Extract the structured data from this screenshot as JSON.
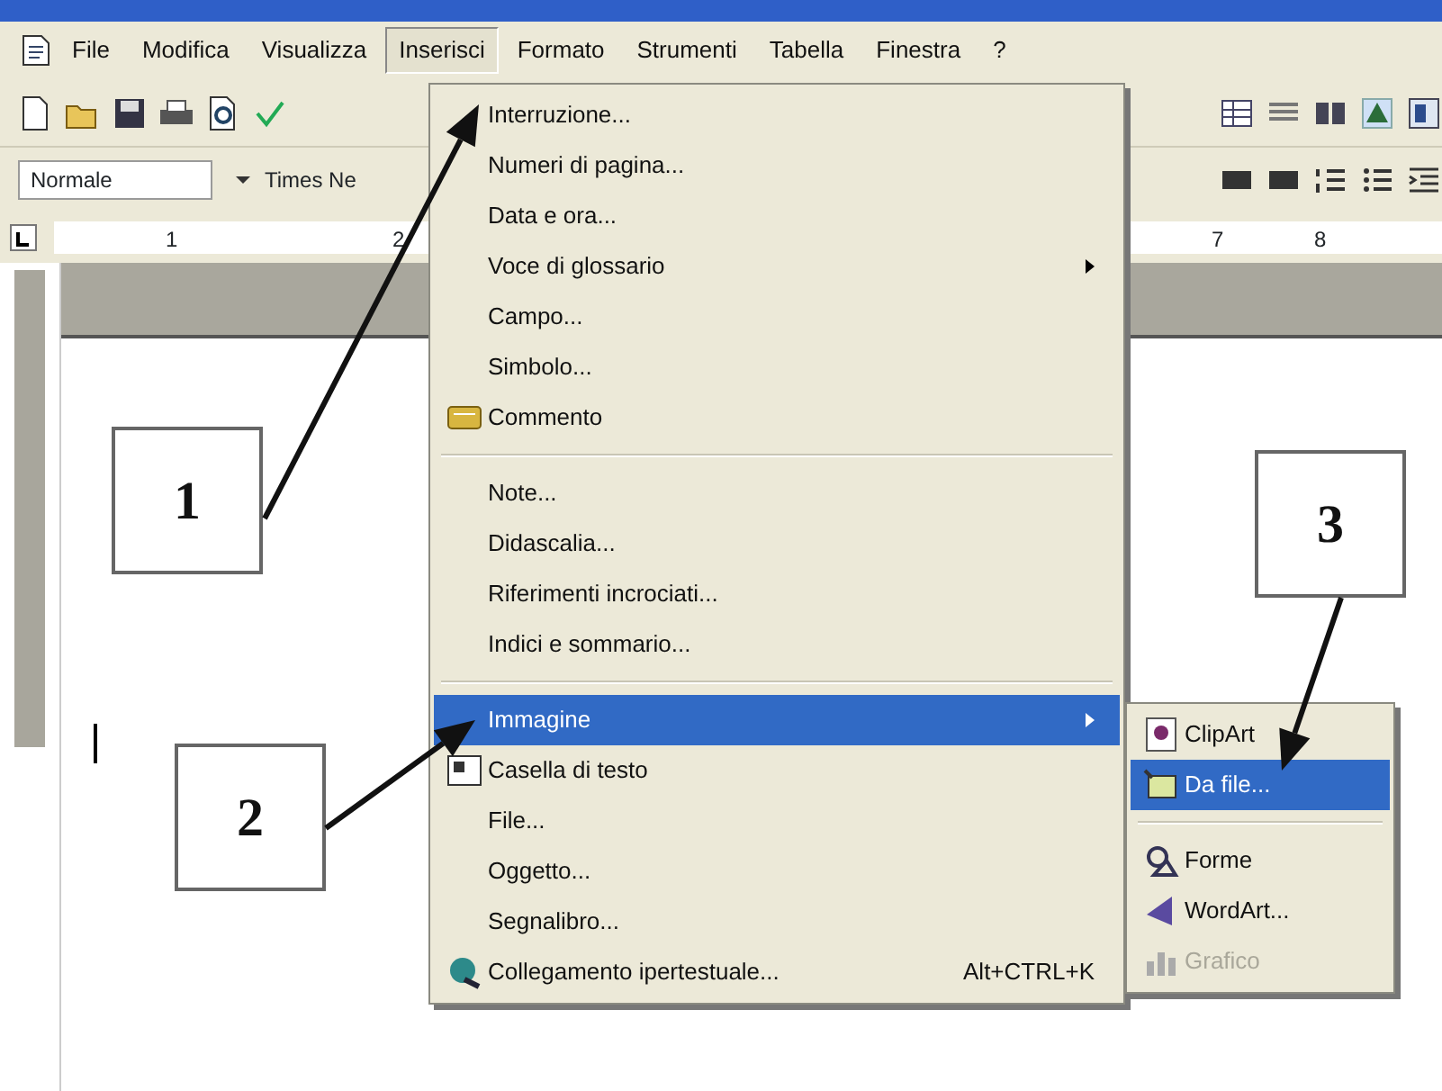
{
  "menubar": {
    "items": [
      {
        "label": "File",
        "selected": false
      },
      {
        "label": "Modifica",
        "selected": false
      },
      {
        "label": "Visualizza",
        "selected": false
      },
      {
        "label": "Inserisci",
        "selected": true
      },
      {
        "label": "Formato",
        "selected": false
      },
      {
        "label": "Strumenti",
        "selected": false
      },
      {
        "label": "Tabella",
        "selected": false
      },
      {
        "label": "Finestra",
        "selected": false
      },
      {
        "label": "?",
        "selected": false
      }
    ]
  },
  "formatting_toolbar": {
    "style": "Normale",
    "font": "Times Ne"
  },
  "ruler": {
    "labels": [
      "1",
      "2",
      "7",
      "8"
    ]
  },
  "insert_menu": {
    "items": [
      {
        "kind": "item",
        "label": "Interruzione...",
        "submenu": false,
        "selected": false
      },
      {
        "kind": "item",
        "label": "Numeri di pagina...",
        "submenu": false,
        "selected": false
      },
      {
        "kind": "item",
        "label": "Data e ora...",
        "submenu": false,
        "selected": false
      },
      {
        "kind": "item",
        "label": "Voce di glossario",
        "submenu": true,
        "selected": false
      },
      {
        "kind": "item",
        "label": "Campo...",
        "submenu": false,
        "selected": false
      },
      {
        "kind": "item",
        "label": "Simbolo...",
        "submenu": false,
        "selected": false
      },
      {
        "kind": "item",
        "label": "Commento",
        "submenu": false,
        "selected": false
      },
      {
        "kind": "separator"
      },
      {
        "kind": "item",
        "label": "Note...",
        "submenu": false,
        "selected": false
      },
      {
        "kind": "item",
        "label": "Didascalia...",
        "submenu": false,
        "selected": false
      },
      {
        "kind": "item",
        "label": "Riferimenti incrociati...",
        "submenu": false,
        "selected": false
      },
      {
        "kind": "item",
        "label": "Indici e sommario...",
        "submenu": false,
        "selected": false
      },
      {
        "kind": "separator"
      },
      {
        "kind": "item",
        "label": "Immagine",
        "submenu": true,
        "selected": true
      },
      {
        "kind": "item",
        "label": "Casella di testo",
        "submenu": false,
        "selected": false
      },
      {
        "kind": "item",
        "label": "File...",
        "submenu": false,
        "selected": false
      },
      {
        "kind": "item",
        "label": "Oggetto...",
        "submenu": false,
        "selected": false
      },
      {
        "kind": "item",
        "label": "Segnalibro...",
        "submenu": false,
        "selected": false
      },
      {
        "kind": "item",
        "label": "Collegamento ipertestuale...",
        "shortcut": "Alt+CTRL+K",
        "submenu": false,
        "selected": false
      }
    ]
  },
  "image_submenu": {
    "items": [
      {
        "kind": "item",
        "label": "ClipArt",
        "selected": false,
        "disabled": false
      },
      {
        "kind": "item",
        "label": "Da file...",
        "selected": true,
        "disabled": false
      },
      {
        "kind": "separator"
      },
      {
        "kind": "item",
        "label": "Forme",
        "selected": false,
        "disabled": false
      },
      {
        "kind": "item",
        "label": "WordArt...",
        "selected": false,
        "disabled": false
      },
      {
        "kind": "item",
        "label": "Grafico",
        "selected": false,
        "disabled": true
      }
    ]
  },
  "annotations": [
    {
      "label": "1"
    },
    {
      "label": "2"
    },
    {
      "label": "3"
    }
  ]
}
